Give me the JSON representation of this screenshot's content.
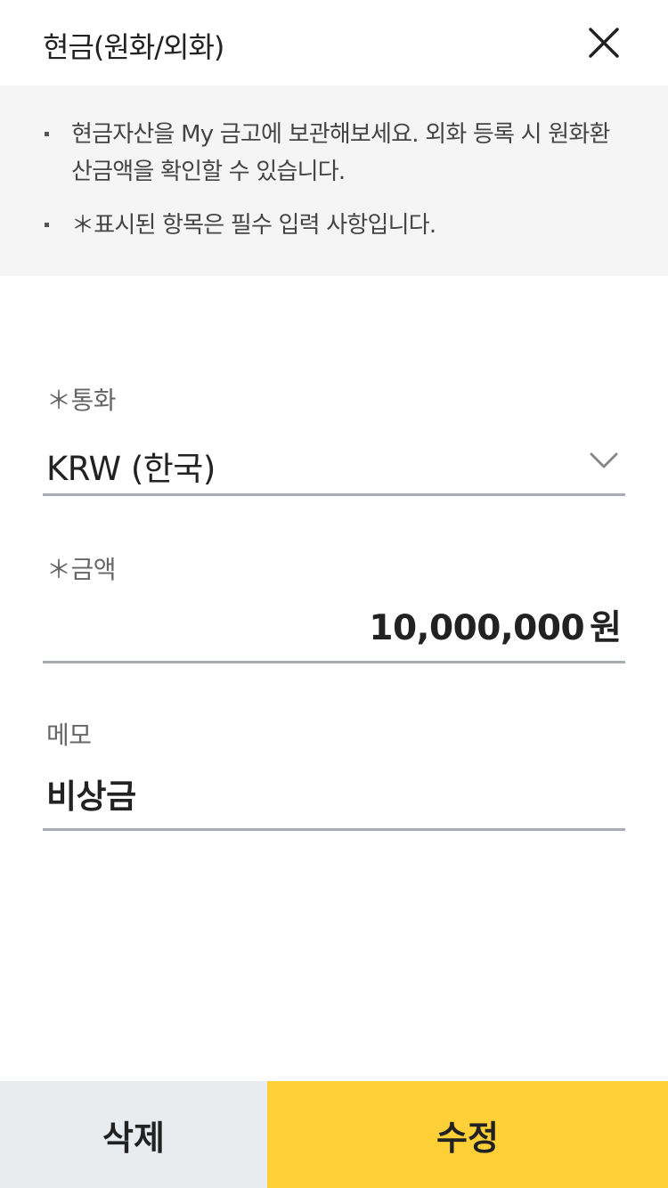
{
  "header": {
    "title": "현금(원화/외화)",
    "close_icon": "close-icon"
  },
  "notice": {
    "items": [
      "현금자산을 My 금고에 보관해보세요. 외화 등록 시 원화환산금액을 확인할 수 있습니다.",
      " ＊표시된 항목은 필수 입력 사항입니다."
    ]
  },
  "form": {
    "currency": {
      "label": "＊통화",
      "value": "KRW (한국)",
      "icon": "chevron-down-icon"
    },
    "amount": {
      "label": "＊금액",
      "value": "10,000,000",
      "unit": "원"
    },
    "memo": {
      "label": "메모",
      "value": "비상금"
    }
  },
  "actions": {
    "delete_label": "삭제",
    "edit_label": "수정"
  },
  "colors": {
    "primary": "#fdd037",
    "secondary": "#e9ecef",
    "notice_bg": "#f5f5f5",
    "underline": "#a9acb0"
  }
}
